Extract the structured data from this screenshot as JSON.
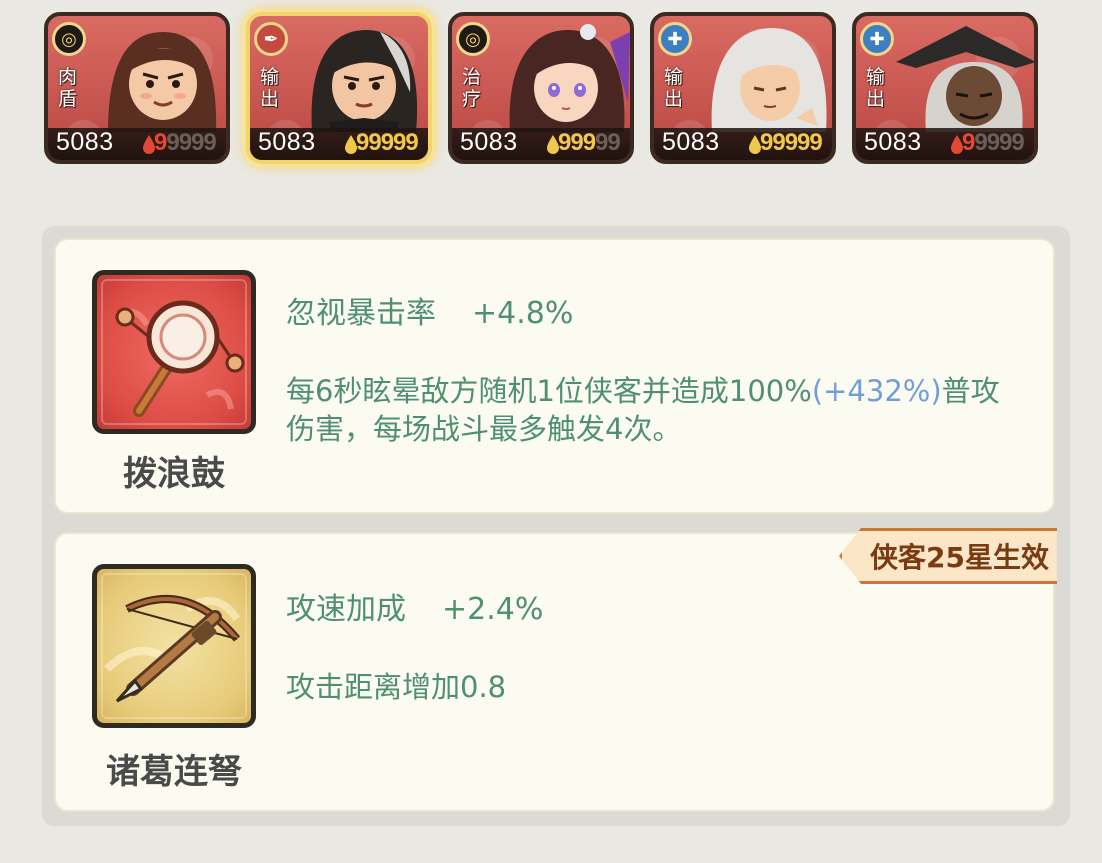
{
  "roster": {
    "heroes": [
      {
        "role_line1": "肉",
        "role_line2": "盾",
        "power": "5083",
        "hp_lit": "9",
        "hp_dim": "9999",
        "hp_style": "red",
        "badge": "swirl-icon",
        "selected": false
      },
      {
        "role_line1": "输",
        "role_line2": "出",
        "power": "5083",
        "hp_lit": "99999",
        "hp_dim": "",
        "hp_style": "gold",
        "badge": "feather-icon",
        "selected": true
      },
      {
        "role_line1": "治",
        "role_line2": "疗",
        "power": "5083",
        "hp_lit": "999",
        "hp_dim": "99",
        "hp_style": "gold",
        "badge": "swirl-icon",
        "selected": false
      },
      {
        "role_line1": "输",
        "role_line2": "出",
        "power": "5083",
        "hp_lit": "99999",
        "hp_dim": "",
        "hp_style": "gold",
        "badge": "sword-icon",
        "selected": false
      },
      {
        "role_line1": "输",
        "role_line2": "出",
        "power": "5083",
        "hp_lit": "9",
        "hp_dim": "9999",
        "hp_style": "red",
        "badge": "sword-icon",
        "selected": false
      }
    ]
  },
  "items": [
    {
      "name": "拨浪鼓",
      "icon": "rattle-drum-icon",
      "stat_label": "忽视暴击率",
      "stat_value": "+4.8%",
      "desc_main": "每6秒眩晕敌方随机1位侠客并造成100%",
      "desc_bonus": "(+432%)",
      "desc_tail": "普攻伤害，每场战斗最多触发4次。"
    },
    {
      "name": "诸葛连弩",
      "icon": "crossbow-icon",
      "stat_label": "攻速加成",
      "stat_value": "+2.4%",
      "desc_main": "攻击距离增加0.8",
      "tag": "侠客25星生效"
    }
  ],
  "colors": {
    "stat_text": "#4f8f73",
    "bonus_text": "#6f9fd6",
    "card_bg": "#fcfbf2",
    "card_frame_red": "#dc4c45",
    "card_frame_gold": "#e7cb79"
  }
}
